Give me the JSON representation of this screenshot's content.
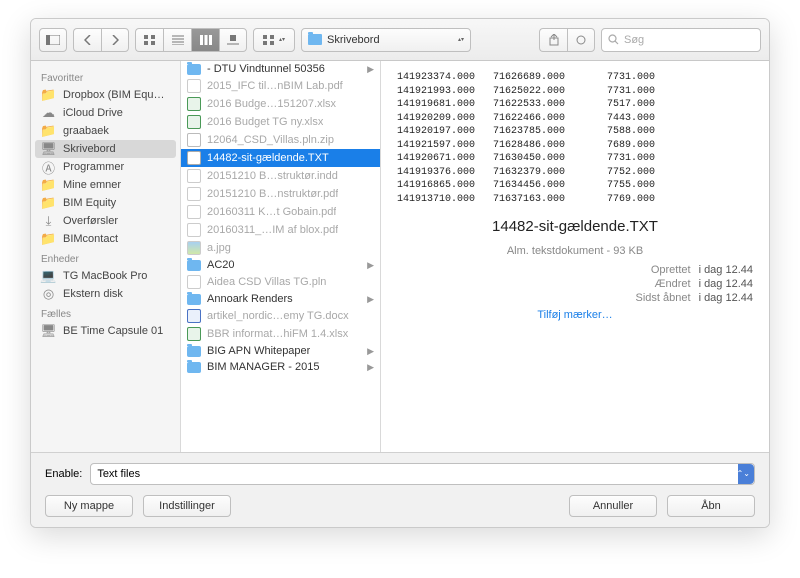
{
  "toolbar": {
    "path_label": "Skrivebord",
    "search_placeholder": "Søg"
  },
  "sidebar": {
    "groups": [
      {
        "header": "Favoritter",
        "items": [
          {
            "label": "Dropbox (BIM Equ…",
            "icon": "folder"
          },
          {
            "label": "iCloud Drive",
            "icon": "cloud"
          },
          {
            "label": "graabaek",
            "icon": "folder"
          },
          {
            "label": "Skrivebord",
            "icon": "desktop",
            "selected": true
          },
          {
            "label": "Programmer",
            "icon": "app"
          },
          {
            "label": "Mine emner",
            "icon": "folder"
          },
          {
            "label": "BIM Equity",
            "icon": "folder"
          },
          {
            "label": "Overførsler",
            "icon": "downloads"
          },
          {
            "label": "BIMcontact",
            "icon": "folder"
          }
        ]
      },
      {
        "header": "Enheder",
        "items": [
          {
            "label": "TG MacBook Pro",
            "icon": "laptop"
          },
          {
            "label": "Ekstern disk",
            "icon": "disk"
          }
        ]
      },
      {
        "header": "Fælles",
        "items": [
          {
            "label": "BE Time Capsule 01",
            "icon": "server"
          }
        ]
      }
    ]
  },
  "files": [
    {
      "label": "- DTU Vindtunnel 50356",
      "kind": "folder",
      "chevron": true
    },
    {
      "label": "2015_IFC til…nBIM Lab.pdf",
      "kind": "pdf",
      "dim": true
    },
    {
      "label": "2016 Budge…151207.xlsx",
      "kind": "xls",
      "dim": true
    },
    {
      "label": "2016 Budget TG ny.xlsx",
      "kind": "xls",
      "dim": true
    },
    {
      "label": "12064_CSD_Villas.pln.zip",
      "kind": "zip",
      "dim": true
    },
    {
      "label": "14482-sit-gældende.TXT",
      "kind": "txt",
      "selected": true
    },
    {
      "label": "20151210 B…struktør.indd",
      "kind": "pdf",
      "dim": true
    },
    {
      "label": "20151210 B…nstruktør.pdf",
      "kind": "pdf",
      "dim": true
    },
    {
      "label": "20160311 K…t Gobain.pdf",
      "kind": "pdf",
      "dim": true
    },
    {
      "label": "20160311_…IM af blox.pdf",
      "kind": "pdf",
      "dim": true
    },
    {
      "label": "a.jpg",
      "kind": "img",
      "dim": true
    },
    {
      "label": "AC20",
      "kind": "folder",
      "chevron": true
    },
    {
      "label": "Aidea CSD Villas TG.pln",
      "kind": "pdf",
      "dim": true
    },
    {
      "label": "Annoark Renders",
      "kind": "folder",
      "chevron": true
    },
    {
      "label": "artikel_nordic…emy TG.docx",
      "kind": "doc",
      "dim": true
    },
    {
      "label": "BBR informat…hiFM 1.4.xlsx",
      "kind": "xls",
      "dim": true
    },
    {
      "label": "BIG APN Whitepaper",
      "kind": "folder",
      "chevron": true
    },
    {
      "label": "BIM MANAGER - 2015",
      "kind": "folder",
      "chevron": true
    }
  ],
  "preview": {
    "text": "141923374.000   71626689.000       7731.000\n141921993.000   71625022.000       7731.000\n141919681.000   71622533.000       7517.000\n141920209.000   71622466.000       7443.000\n141920197.000   71623785.000       7588.000\n141921597.000   71628486.000       7689.000\n141920671.000   71630450.000       7731.000\n141919376.000   71632379.000       7752.000\n141916865.000   71634456.000       7755.000\n141913710.000   71637163.000       7769.000\n",
    "title": "14482-sit-gældende.TXT",
    "desc": "Alm. tekstdokument - 93 KB",
    "created_k": "Oprettet",
    "created_v": "i dag 12.44",
    "modified_k": "Ændret",
    "modified_v": "i dag 12.44",
    "opened_k": "Sidst åbnet",
    "opened_v": "i dag 12.44",
    "tags": "Tilføj mærker…"
  },
  "bottom": {
    "enable_label": "Enable:",
    "enable_value": "Text files",
    "new_folder": "Ny mappe",
    "settings": "Indstillinger",
    "cancel": "Annuller",
    "open": "Åbn"
  }
}
